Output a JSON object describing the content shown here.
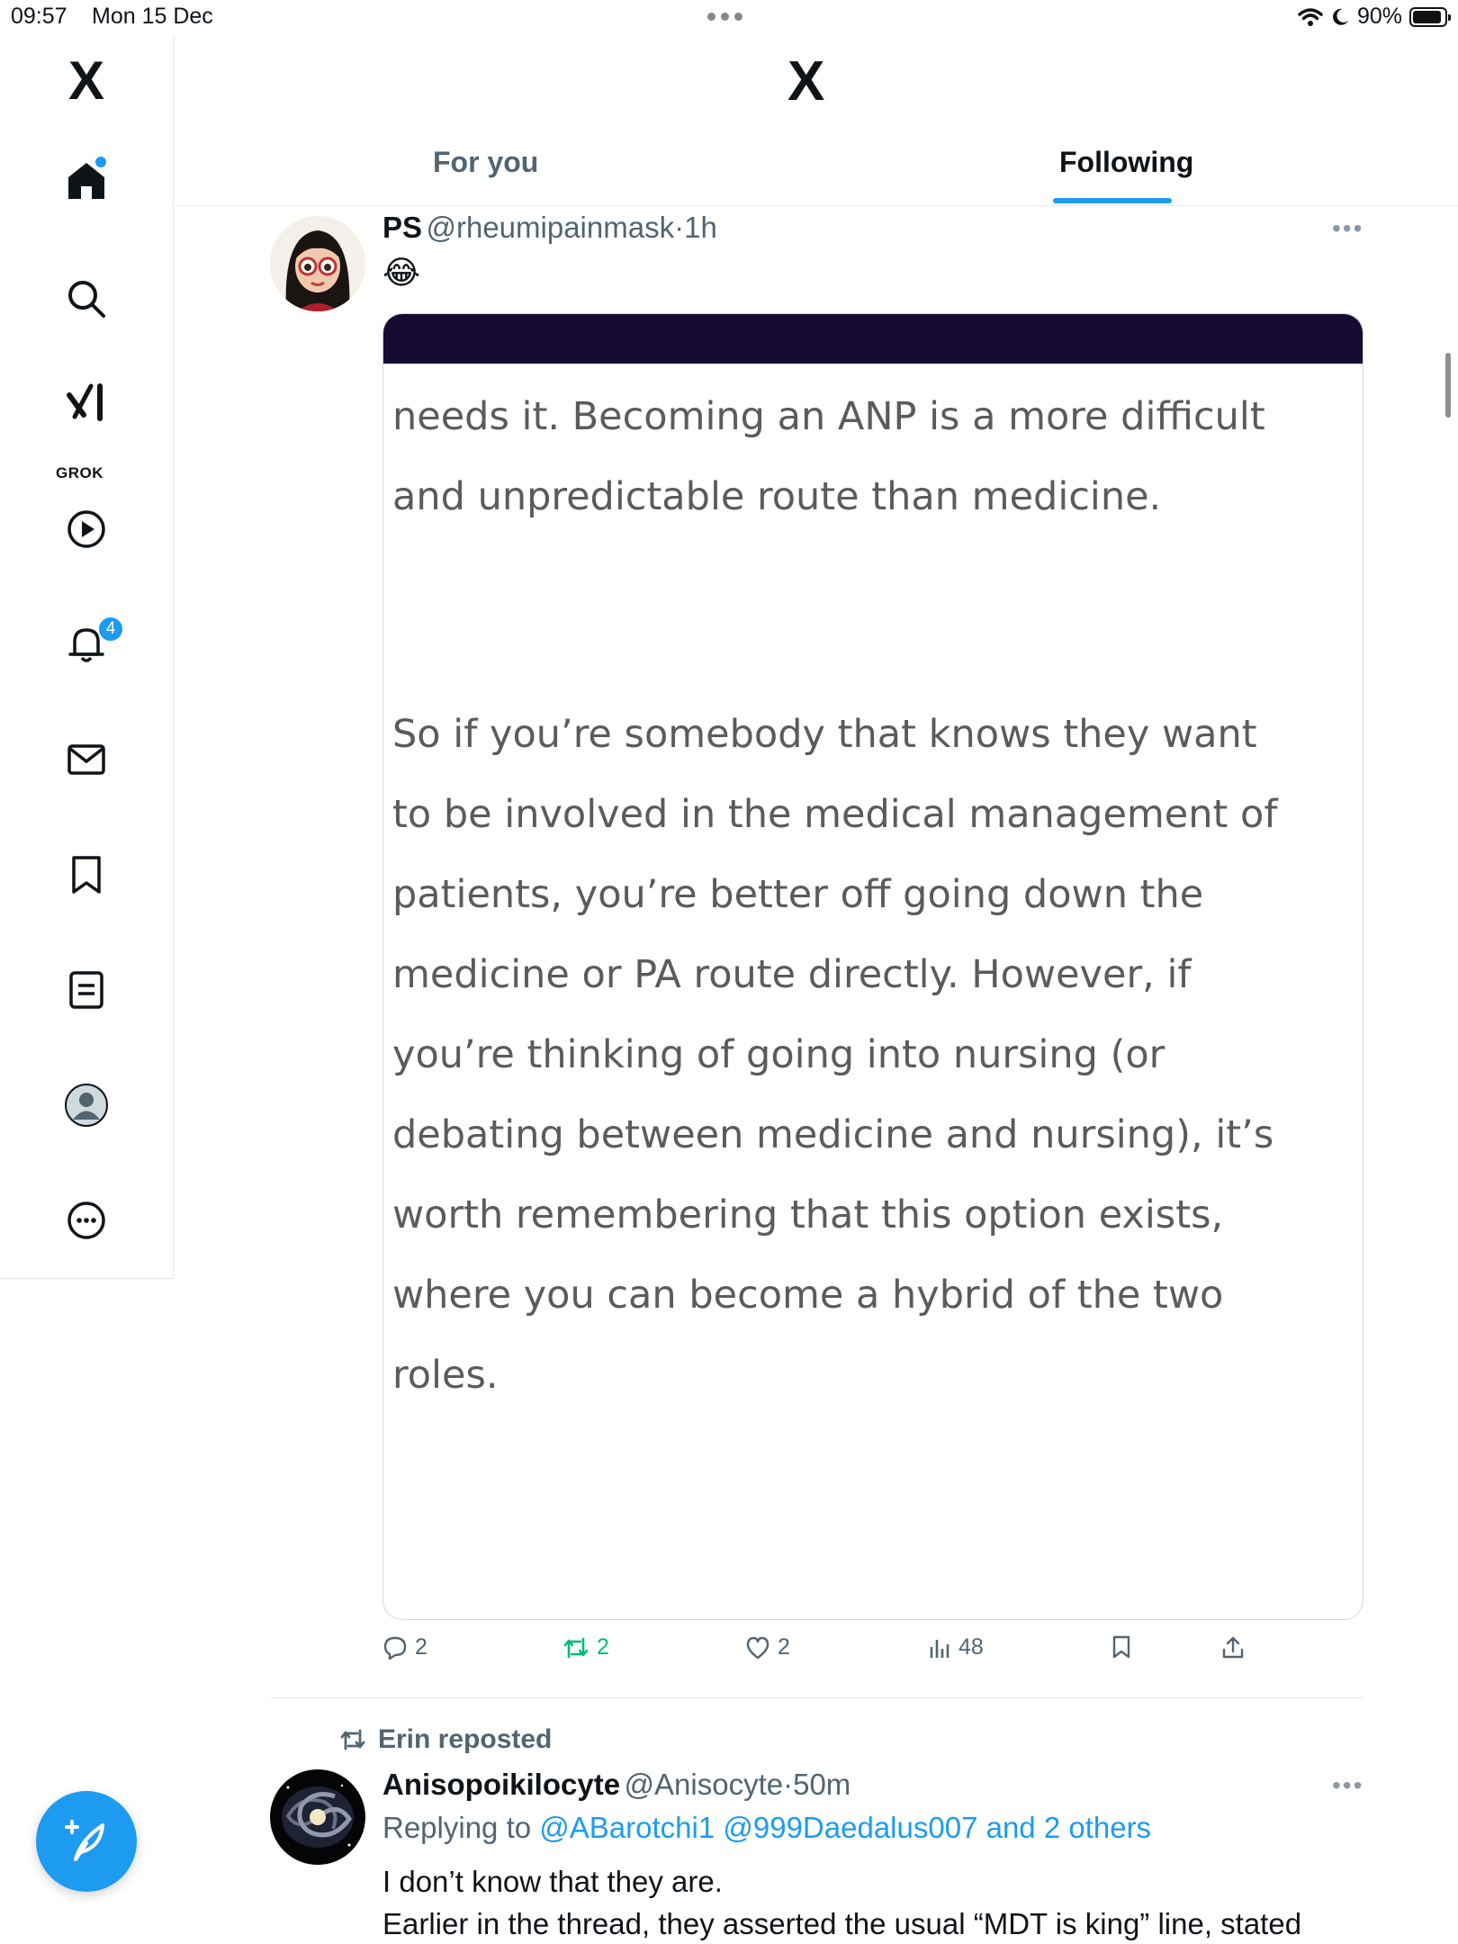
{
  "status_bar": {
    "time": "09:57",
    "date": "Mon 15 Dec",
    "battery": "90%"
  },
  "sidebar": {
    "logo": "X",
    "items": [
      {
        "name": "home",
        "icon": "home-icon"
      },
      {
        "name": "search",
        "icon": "search-icon"
      },
      {
        "name": "grok",
        "icon": "grok-icon",
        "label": "GROK"
      },
      {
        "name": "video",
        "icon": "play-icon"
      },
      {
        "name": "notifications",
        "icon": "bell-icon",
        "badge": "4"
      },
      {
        "name": "messages",
        "icon": "mail-icon"
      },
      {
        "name": "bookmarks",
        "icon": "bookmark-icon"
      },
      {
        "name": "lists",
        "icon": "list-icon"
      },
      {
        "name": "profile",
        "icon": "profile-icon"
      },
      {
        "name": "more",
        "icon": "more-circle-icon"
      }
    ],
    "compose_icon": "compose-icon"
  },
  "header": {
    "logo": "X",
    "tabs": [
      {
        "label": "For you",
        "active": false
      },
      {
        "label": "Following",
        "active": true
      }
    ]
  },
  "tweet1": {
    "name": "PS",
    "handle": "@rheumipainmask",
    "separator": "·",
    "time": "1h",
    "emoji": "😂",
    "media_lines": [
      "needs it. Becoming an ANP is a more difficult",
      "and unpredictable route than medicine.",
      "",
      "",
      "So if you’re somebody that knows they want",
      "to be involved in the medical management of",
      "patients, you’re better off going down the",
      "medicine or PA route directly. However, if",
      "you’re thinking of going into nursing (or",
      "debating between medicine and nursing), it’s",
      "worth remembering that this option exists,",
      "where you can become a hybrid of the two",
      "roles."
    ],
    "actions": {
      "replies": "2",
      "reposts": "2",
      "likes": "2",
      "views": "48"
    }
  },
  "tweet2": {
    "reposted_by": "Erin reposted",
    "name": "Anisopoikilocyte",
    "handle": "@Anisocyte",
    "separator": "·",
    "time": "50m",
    "replying_prefix": "Replying to",
    "replying_to": "@ABarotchi1 @999Daedalus007 and 2 others",
    "line1": "I don’t know that they are.",
    "line2": "Earlier in the thread, they asserted the usual “MDT is king” line, stated"
  },
  "colors": {
    "accent": "#1d9bf0",
    "repost_green": "#00ba7c",
    "secondary_text": "#536471"
  }
}
